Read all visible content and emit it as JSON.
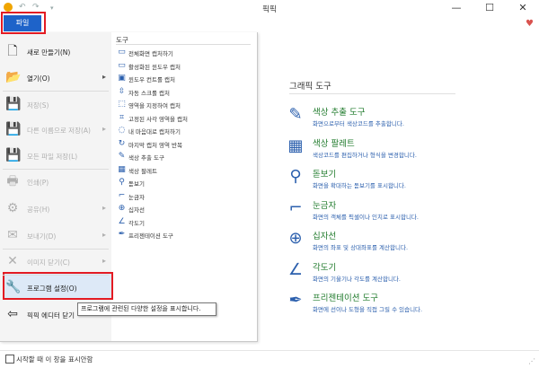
{
  "window": {
    "title": "픽픽",
    "minimize": "—",
    "maximize": "☐",
    "close": "✕"
  },
  "quick_access": {
    "undo": "↶",
    "redo": "↷",
    "dropdown": "▾"
  },
  "file_tab": {
    "label": "파일"
  },
  "menu": {
    "items": [
      {
        "label": "새로 만들기(N)",
        "icon": "new-file-icon",
        "glyph": "🗋",
        "disabled": false,
        "submenu": false
      },
      {
        "label": "열기(O)",
        "icon": "open-folder-icon",
        "glyph": "📂",
        "disabled": false,
        "submenu": true
      },
      {
        "label": "저장(S)",
        "icon": "save-icon",
        "glyph": "💾",
        "disabled": true,
        "submenu": false
      },
      {
        "label": "다른 이름으로 저장(A)",
        "icon": "save-as-icon",
        "glyph": "💾",
        "disabled": true,
        "submenu": true
      },
      {
        "label": "모든 파일 저장(L)",
        "icon": "save-all-icon",
        "glyph": "💾",
        "disabled": true,
        "submenu": false
      },
      {
        "label": "인쇄(P)",
        "icon": "print-icon",
        "glyph": "🖶",
        "disabled": true,
        "submenu": false
      },
      {
        "label": "공유(H)",
        "icon": "share-icon",
        "glyph": "⚙",
        "disabled": true,
        "submenu": true
      },
      {
        "label": "보내기(D)",
        "icon": "send-icon",
        "glyph": "✉",
        "disabled": true,
        "submenu": true
      },
      {
        "label": "이미지 닫기(C)",
        "icon": "close-image-icon",
        "glyph": "✕",
        "disabled": true,
        "submenu": true
      },
      {
        "label": "프로그램 설정(O)",
        "icon": "settings-wrench-icon",
        "glyph": "🔧",
        "disabled": false,
        "submenu": false
      },
      {
        "label": "픽픽 에디터 닫기",
        "icon": "exit-icon",
        "glyph": "⇦",
        "disabled": false,
        "submenu": false
      }
    ],
    "tooltip": "프로그램에 관련된 다양한 설정을 표시합니다."
  },
  "tools_menu": {
    "header": "도구",
    "items": [
      {
        "label": "전체화면 캡처하기",
        "icon": "monitor-icon",
        "glyph": "▭"
      },
      {
        "label": "활성화된 윈도우 캡처",
        "icon": "window-icon",
        "glyph": "▭"
      },
      {
        "label": "윈도우 컨트롤 캡처",
        "icon": "window-control-icon",
        "glyph": "▣"
      },
      {
        "label": "자동 스크롤 캡처",
        "icon": "scroll-icon",
        "glyph": "⇳"
      },
      {
        "label": "영역을 지정하여 캡처",
        "icon": "region-icon",
        "glyph": "⬚"
      },
      {
        "label": "고정된 사각 영역을 캡처",
        "icon": "fixed-region-icon",
        "glyph": "⌗"
      },
      {
        "label": "내 마음대로 캡처하기",
        "icon": "freehand-icon",
        "glyph": "◌"
      },
      {
        "label": "마지막 캡처 영역 반복",
        "icon": "repeat-icon",
        "glyph": "↻"
      },
      {
        "label": "색상 추출 도구",
        "icon": "eyedropper-icon",
        "glyph": "✎"
      },
      {
        "label": "색상 팔레트",
        "icon": "palette-icon",
        "glyph": "▦"
      },
      {
        "label": "돋보기",
        "icon": "magnifier-icon",
        "glyph": "⚲"
      },
      {
        "label": "눈금자",
        "icon": "ruler-icon",
        "glyph": "⌐"
      },
      {
        "label": "십자선",
        "icon": "crosshair-icon",
        "glyph": "⊕"
      },
      {
        "label": "각도기",
        "icon": "protractor-icon",
        "glyph": "∠"
      },
      {
        "label": "프리젠테이션 도구",
        "icon": "presentation-pen-icon",
        "glyph": "✒"
      }
    ]
  },
  "graphic_tools": {
    "title": "그래픽 도구",
    "items": [
      {
        "name": "색상 추출 도구",
        "desc": "화면으로부터 색상코드를 추출합니다.",
        "icon": "eyedropper-icon",
        "glyph": "✎"
      },
      {
        "name": "색상 팔레트",
        "desc": "색상코드를 편집하거나 형식을 변경합니다.",
        "icon": "palette-icon",
        "glyph": "▦"
      },
      {
        "name": "돋보기",
        "desc": "화면을 확대하는 돋보기를 표시합니다.",
        "icon": "magnifier-icon",
        "glyph": "⚲"
      },
      {
        "name": "눈금자",
        "desc": "화면의 객체를 픽셀이나 인치로 표시합니다.",
        "icon": "ruler-icon",
        "glyph": "⌐"
      },
      {
        "name": "십자선",
        "desc": "화면의 좌표 및 상대좌표를 계산합니다.",
        "icon": "crosshair-icon",
        "glyph": "⊕"
      },
      {
        "name": "각도기",
        "desc": "화면의 기울기나 각도를 계산합니다.",
        "icon": "protractor-icon",
        "glyph": "∠"
      },
      {
        "name": "프리젠테이션 도구",
        "desc": "화면에 선이나 도형을 직접 그릴 수 있습니다.",
        "icon": "presentation-pen-icon",
        "glyph": "✒"
      }
    ]
  },
  "bottom": {
    "checkbox_label": "시작할 때 이 창을 표시안함",
    "checked": false
  },
  "colors": {
    "accent": "#1e63c9",
    "highlight_border": "#e31b23",
    "tool_name": "#217b2d",
    "tool_desc": "#2b5fad"
  }
}
